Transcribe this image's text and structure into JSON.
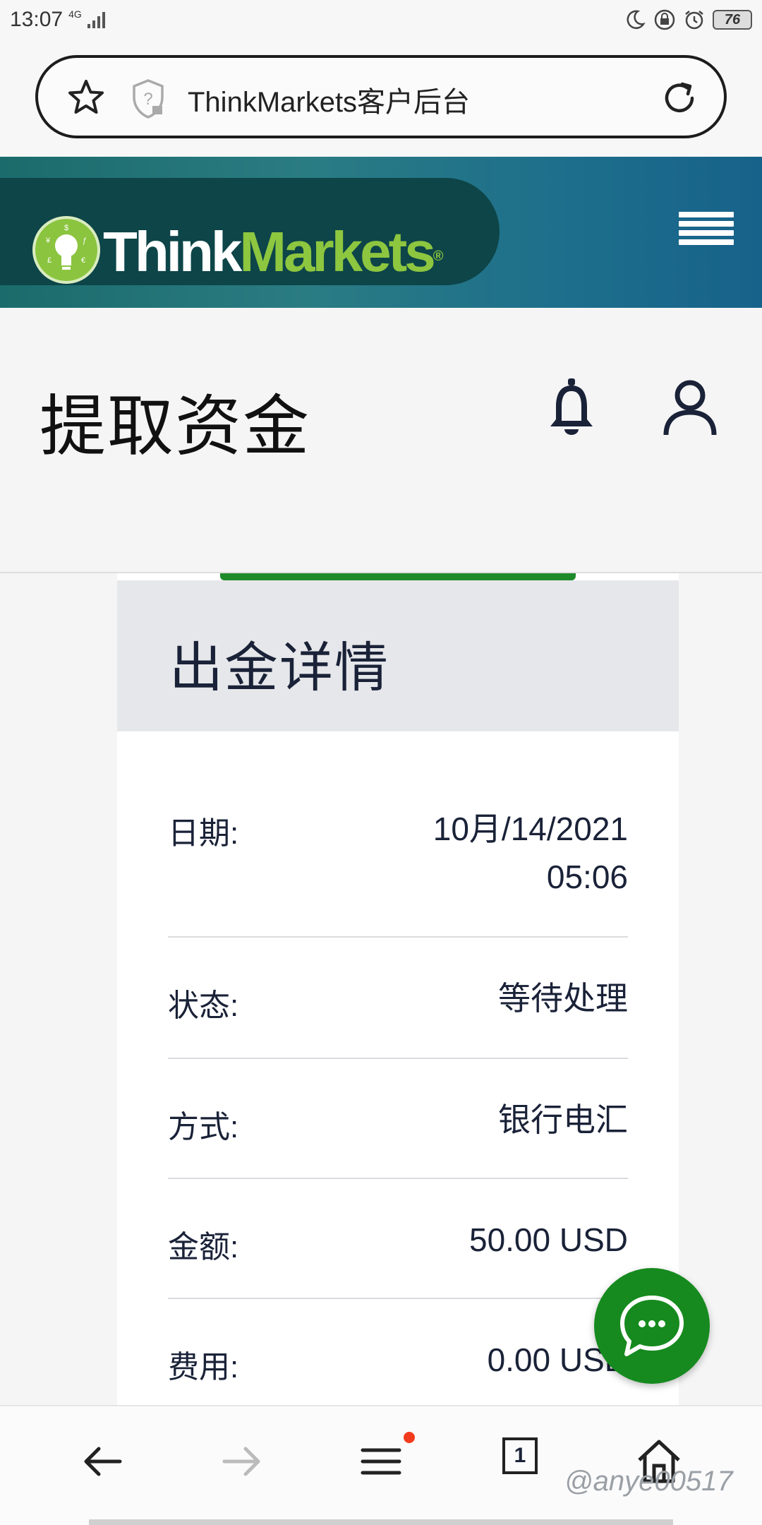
{
  "status_bar": {
    "time": "13:07",
    "network": "4G",
    "battery": "76"
  },
  "browser": {
    "url_title": "ThinkMarkets客户后台"
  },
  "brand": {
    "think": "Think",
    "markets": "Markets",
    "reg": "®"
  },
  "page": {
    "title": "提取资金"
  },
  "card": {
    "title": "出金详情",
    "rows": [
      {
        "label": "日期:",
        "value_line1": "10月/14/2021",
        "value_line2": "05:06"
      },
      {
        "label": "状态:",
        "value": "等待处理"
      },
      {
        "label": "方式:",
        "value": "银行电汇"
      },
      {
        "label": "金额:",
        "value": "50.00 USD"
      },
      {
        "label": "费用:",
        "value": "0.00 USD"
      }
    ]
  },
  "bottom_nav": {
    "tab_count": "1"
  },
  "watermark": "@anye00517",
  "colors": {
    "accent": "#1e8a2a",
    "brand_green": "#8dc63f",
    "brand_dark": "#0d4548",
    "chat_green": "#168a1e"
  },
  "icons": [
    "star-icon",
    "shield-icon",
    "reload-icon",
    "menu-icon",
    "bell-icon",
    "user-icon",
    "chat-icon",
    "back-icon",
    "forward-icon",
    "tabs-icon",
    "home-icon"
  ]
}
